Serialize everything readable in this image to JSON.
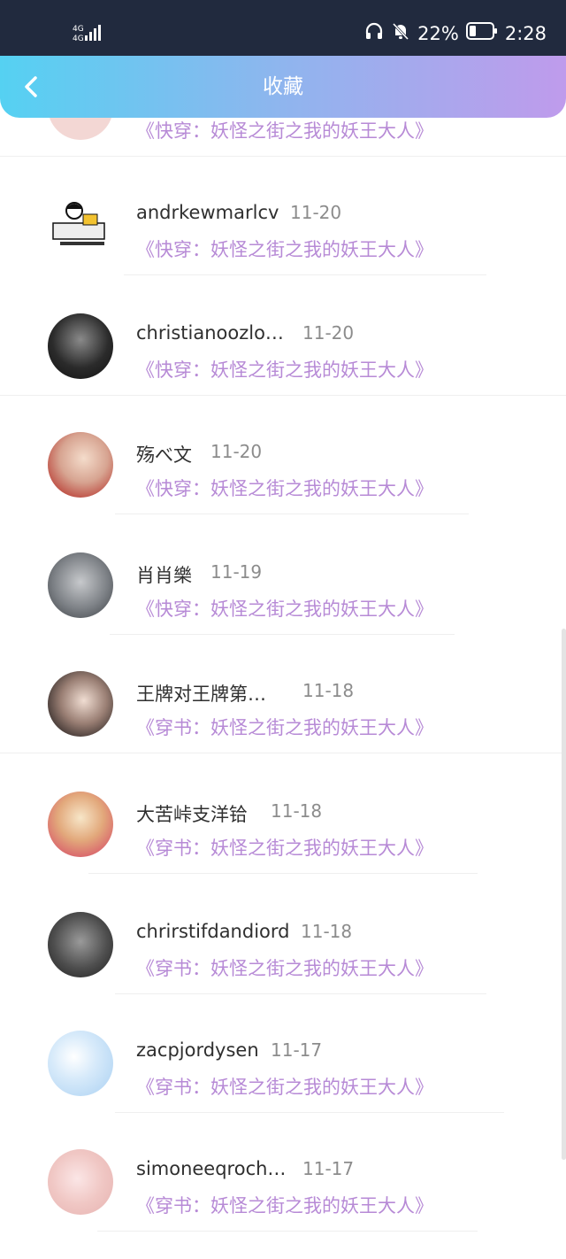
{
  "status_bar": {
    "network": "4G",
    "battery": "22%",
    "time": "2:28"
  },
  "header": {
    "title": "收藏"
  },
  "list": [
    {
      "name": "",
      "date": "",
      "book": "《快穿：妖怪之街之我的妖王大人》"
    },
    {
      "name": "andrkewmarlcv",
      "date": "11-20",
      "book": "《快穿：妖怪之街之我的妖王大人》"
    },
    {
      "name": "christianoozlo…",
      "date": "11-20",
      "book": "《快穿：妖怪之街之我的妖王大人》"
    },
    {
      "name": "殇べ文",
      "date": "11-20",
      "book": "《快穿：妖怪之街之我的妖王大人》"
    },
    {
      "name": "肖肖樂",
      "date": "11-19",
      "book": "《快穿：妖怪之街之我的妖王大人》"
    },
    {
      "name": "王牌对王牌第…",
      "date": "11-18",
      "book": "《穿书：妖怪之街之我的妖王大人》"
    },
    {
      "name": "大苦峠支洋铪",
      "date": "11-18",
      "book": "《穿书：妖怪之街之我的妖王大人》"
    },
    {
      "name": "chrirstifdandiord",
      "date": "11-18",
      "book": "《穿书：妖怪之街之我的妖王大人》"
    },
    {
      "name": "zacpjordysen",
      "date": "11-17",
      "book": "《穿书：妖怪之街之我的妖王大人》"
    },
    {
      "name": "simoneeqroch…",
      "date": "11-17",
      "book": "《穿书：妖怪之街之我的妖王大人》"
    }
  ]
}
